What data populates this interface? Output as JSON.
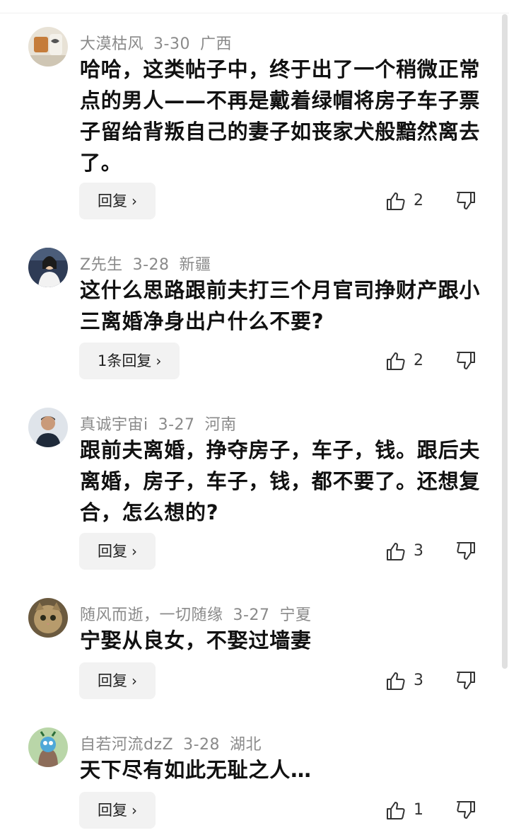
{
  "comments": [
    {
      "username": "大漠枯风",
      "date": "3-30",
      "location": "广西",
      "text": "哈哈，这类帖子中，终于出了一个稍微正常点的男人——不再是戴着绿帽将房子车子票子留给背叛自己的妻子如丧家犬般黯然离去了。",
      "reply_label": "回复",
      "likes": "2"
    },
    {
      "username": "Z先生",
      "date": "3-28",
      "location": "新疆",
      "text": "这什么思路跟前夫打三个月官司挣财产跟小三离婚净身出户什么不要?",
      "reply_label": "1条回复",
      "likes": "2"
    },
    {
      "username": "真诚宇宙i",
      "date": "3-27",
      "location": "河南",
      "text": "跟前夫离婚，挣夺房子，车子，钱。跟后夫离婚，房子，车子，钱，都不要了。还想复合，怎么想的?",
      "reply_label": "回复",
      "likes": "3"
    },
    {
      "username": "随风而逝，一切随缘",
      "date": "3-27",
      "location": "宁夏",
      "text": "宁娶从良女，不娶过墙妻",
      "reply_label": "回复",
      "likes": "3"
    },
    {
      "username": "自若河流dzZ",
      "date": "3-28",
      "location": "湖北",
      "text": "天下尽有如此无耻之人…",
      "reply_label": "回复",
      "likes": "1"
    }
  ],
  "icons": {
    "like": "thumbs-up-icon",
    "dislike": "thumbs-down-icon",
    "chevron": "chevron-right-icon"
  },
  "colors": {
    "meta_text": "#8a8a8a",
    "reply_bg": "#f2f2f2",
    "body_text": "#111111"
  }
}
